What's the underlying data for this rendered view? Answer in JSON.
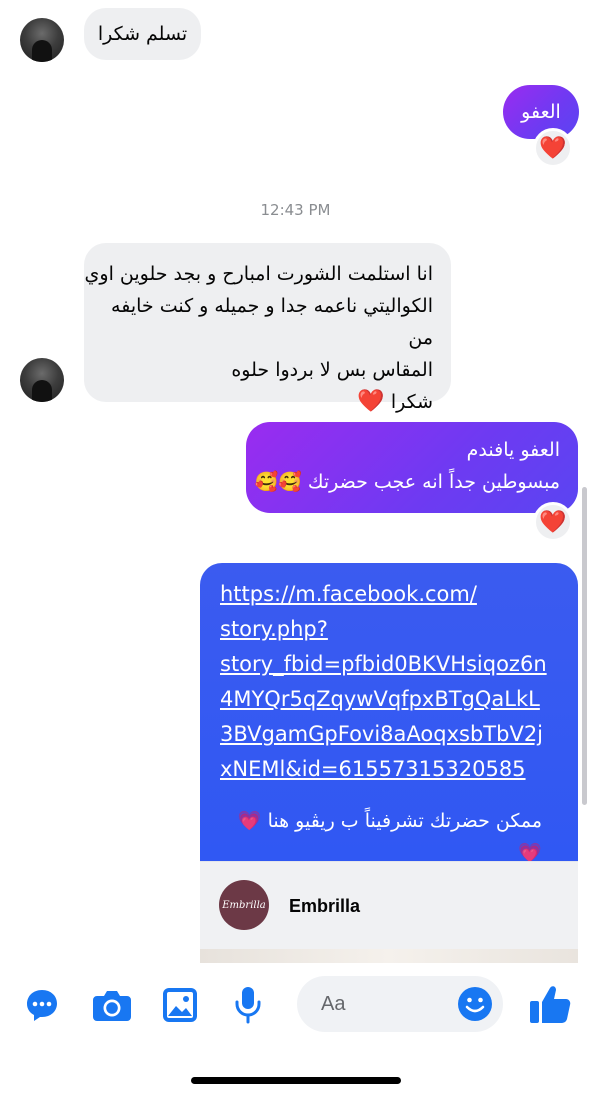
{
  "messages": {
    "m1_text": "تسلم شكرا",
    "m2_text": "العفو",
    "timestamp": "12:43 PM",
    "m3_lines": [
      "انا استلمت الشورت امبارح و بجد حلوين اوي",
      "الكواليتي ناعمه جدا و جميله و كنت خايفه من",
      "المقاس بس لا بردوا حلوه",
      "شكرا"
    ],
    "m4_line1": "العفو يافندم",
    "m4_line2": "مبسوطين جداً انه عجب حضرتك",
    "link_lines": [
      "https://m.facebook.com/",
      "story.php?",
      "story_fbid=pfbid0BKVHsiqoz6n",
      "4MYQr5qZqywVqfpxBTgQaLkL",
      "3BVgamGpFovi8aAoqxsbTbV2j",
      "xNEMl&id=61557315320585"
    ],
    "link_caption": "ممكن حضرتك تشرفيناً ب ريڤيو هنا",
    "preview_title": "Embrilla",
    "preview_logo_text": "Embrilla"
  },
  "reactions": {
    "heart": "❤️",
    "smile_hearts": "🥰",
    "pink_heart": "💗"
  },
  "composer": {
    "placeholder": "Aa"
  },
  "toolbar": {
    "icons": [
      "apps-icon",
      "camera-icon",
      "gallery-icon",
      "microphone-icon",
      "emoji-icon",
      "thumbs-up-icon"
    ]
  },
  "colors": {
    "accent": "#1877f2",
    "incoming_bubble": "#eeeff1",
    "outgoing_purple": "#8b31f1",
    "link_card_blue": "#3058f3"
  }
}
